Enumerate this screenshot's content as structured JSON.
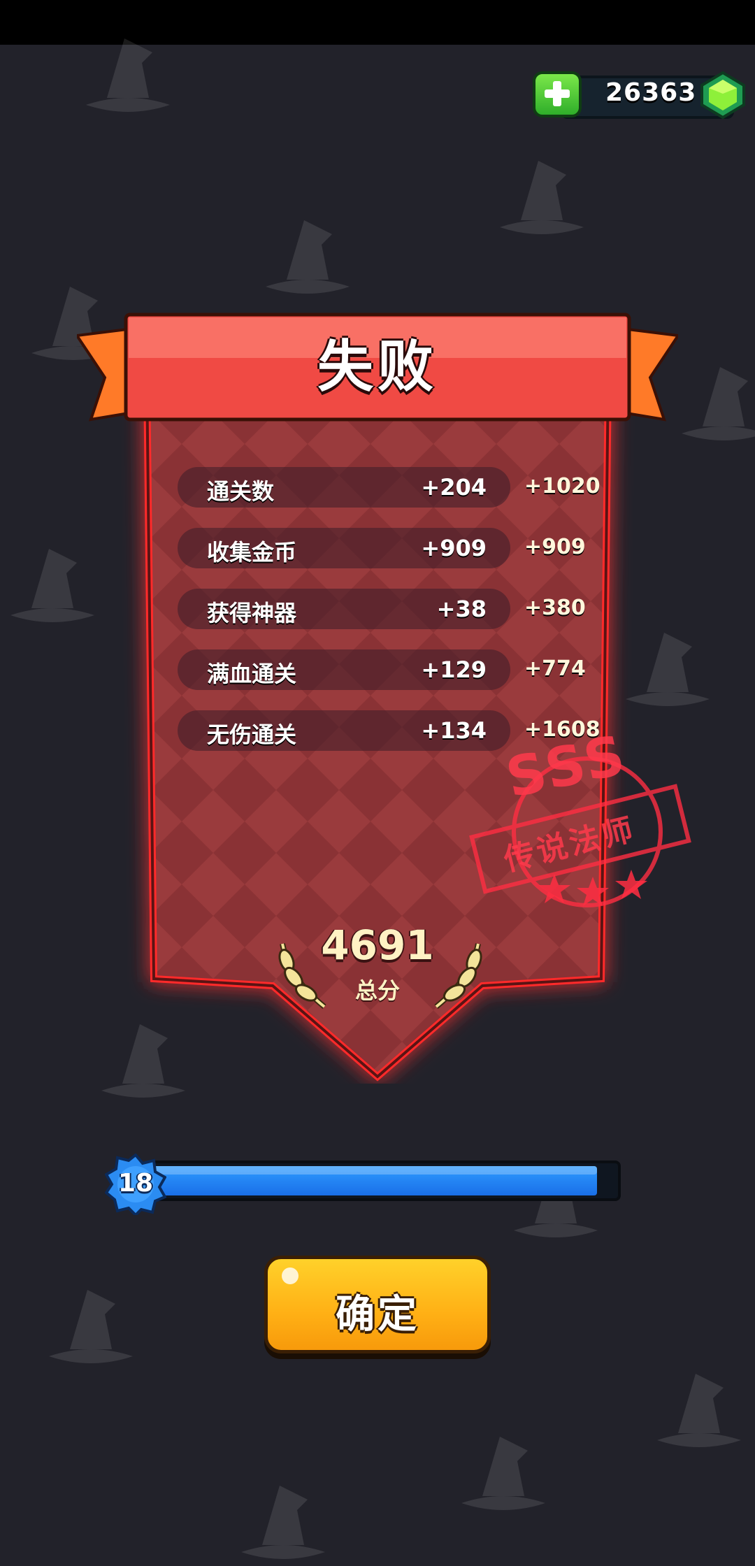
{
  "currency": {
    "amount": "26363",
    "icon": "green-gem-icon",
    "add_icon": "plus-icon"
  },
  "result": {
    "title": "失败"
  },
  "rows": [
    {
      "label": "通关数",
      "value": "+204",
      "bonus": "+1020"
    },
    {
      "label": "收集金币",
      "value": "+909",
      "bonus": "+909"
    },
    {
      "label": "获得神器",
      "value": "+38",
      "bonus": "+380"
    },
    {
      "label": "满血通关",
      "value": "+129",
      "bonus": "+774"
    },
    {
      "label": "无伤通关",
      "value": "+134",
      "bonus": "+1608"
    }
  ],
  "rating": {
    "grade": "SSS",
    "title": "传说法师",
    "stars": 3
  },
  "total": {
    "value": "4691",
    "label": "总分"
  },
  "level": {
    "number": "18",
    "progress_percent": 96
  },
  "confirm": {
    "label": "确定"
  },
  "colors": {
    "banner": "#e8453e",
    "panel": "#7a2a2c",
    "glow": "#ff2020",
    "progress": "#2e9bff",
    "button": "#ffc21a"
  }
}
